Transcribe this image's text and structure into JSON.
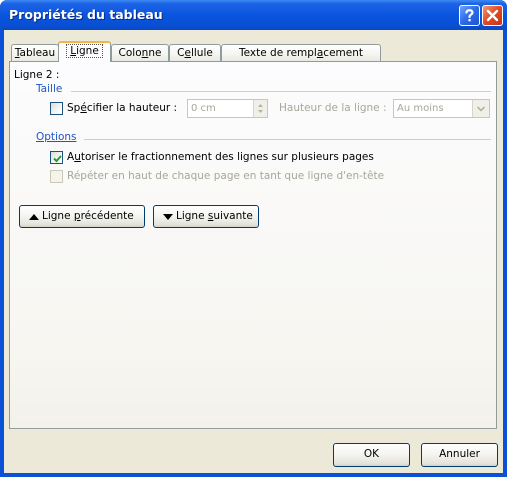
{
  "window": {
    "title": "Propriétés du tableau"
  },
  "tabs": [
    {
      "before": "",
      "accel": "T",
      "after": "ableau"
    },
    {
      "before": "",
      "accel": "L",
      "after": "igne"
    },
    {
      "before": "Colo",
      "accel": "n",
      "after": "ne"
    },
    {
      "before": "C",
      "accel": "e",
      "after": "llule"
    },
    {
      "before": "Texte de rempl",
      "accel": "a",
      "after": "cement"
    }
  ],
  "row_label": "Ligne 2 :",
  "size_section": {
    "heading": "Taille",
    "specify_height": {
      "before": "Sp",
      "accel": "é",
      "after": "cifier la hauteur :",
      "checked": false
    },
    "height_value": "0 cm",
    "row_height_label": "Hauteur de la ligne :",
    "row_height_mode": "Au moins"
  },
  "options_section": {
    "heading": "Options",
    "allow_break": {
      "before": "A",
      "accel": "u",
      "after": "toriser le fractionnement des lignes sur plusieurs pages",
      "checked": true
    },
    "repeat_header": {
      "label": "Répéter en haut de chaque page en tant que ligne d'en-tête",
      "checked": false,
      "disabled": true
    }
  },
  "nav_buttons": {
    "previous": {
      "before": "Ligne ",
      "accel": "p",
      "after": "récédente"
    },
    "next": {
      "before": "Ligne ",
      "accel": "s",
      "after": "uivante"
    }
  },
  "footer": {
    "ok": "OK",
    "cancel": "Annuler"
  },
  "colors": {
    "title_bar": "#0a55de",
    "dialog_bg": "#ece9d8",
    "accent_blue": "#2154c4",
    "active_tab_top": "#f7b248",
    "checkmark": "#21a121"
  }
}
